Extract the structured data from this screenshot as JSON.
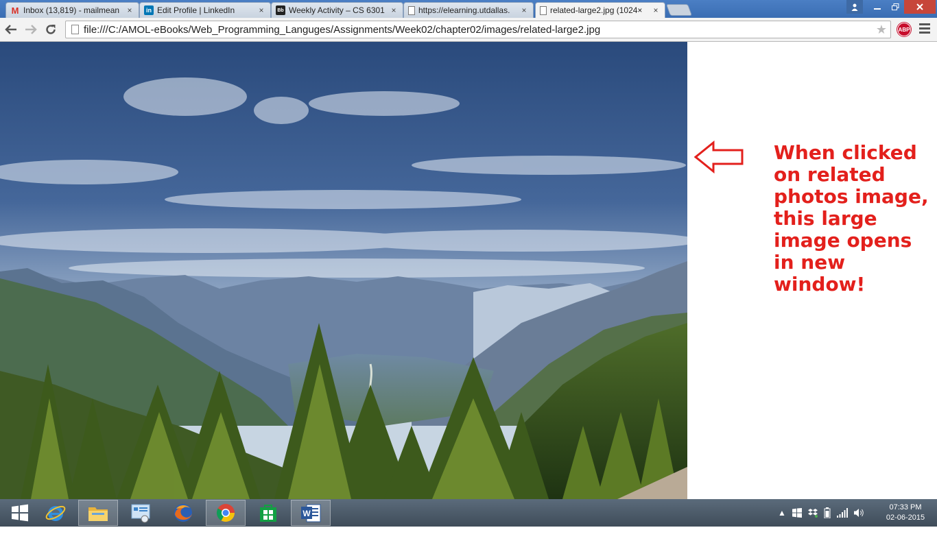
{
  "browser": {
    "tabs": [
      {
        "title": "Inbox (13,819) - mailmean",
        "favicon": "gmail-icon",
        "active": false
      },
      {
        "title": "Edit Profile | LinkedIn",
        "favicon": "linkedin-icon",
        "active": false
      },
      {
        "title": "Weekly Activity – CS 6301",
        "favicon": "blackboard-icon",
        "active": false
      },
      {
        "title": "https://elearning.utdallas.",
        "favicon": "page-icon",
        "active": false
      },
      {
        "title": "related-large2.jpg (1024×",
        "favicon": "page-icon",
        "active": true
      }
    ],
    "tab_close_glyph": "×",
    "address_bar": {
      "url": "file:///C:/AMOL-eBooks/Web_Programming_Languges/Assignments/Week02/chapter02/images/related-large2.jpg"
    },
    "extension_badge": "ABP"
  },
  "content": {
    "annotation": "When clicked on related photos image, this large image opens in new window!",
    "annotation_color": "#e3201c"
  },
  "taskbar": {
    "apps": [
      "start-icon",
      "internet-explorer-icon",
      "file-explorer-icon",
      "control-panel-icon",
      "firefox-icon",
      "chrome-icon",
      "windows-store-icon",
      "word-icon"
    ],
    "clock": {
      "time": "07:33 PM",
      "date": "02-06-2015"
    }
  }
}
